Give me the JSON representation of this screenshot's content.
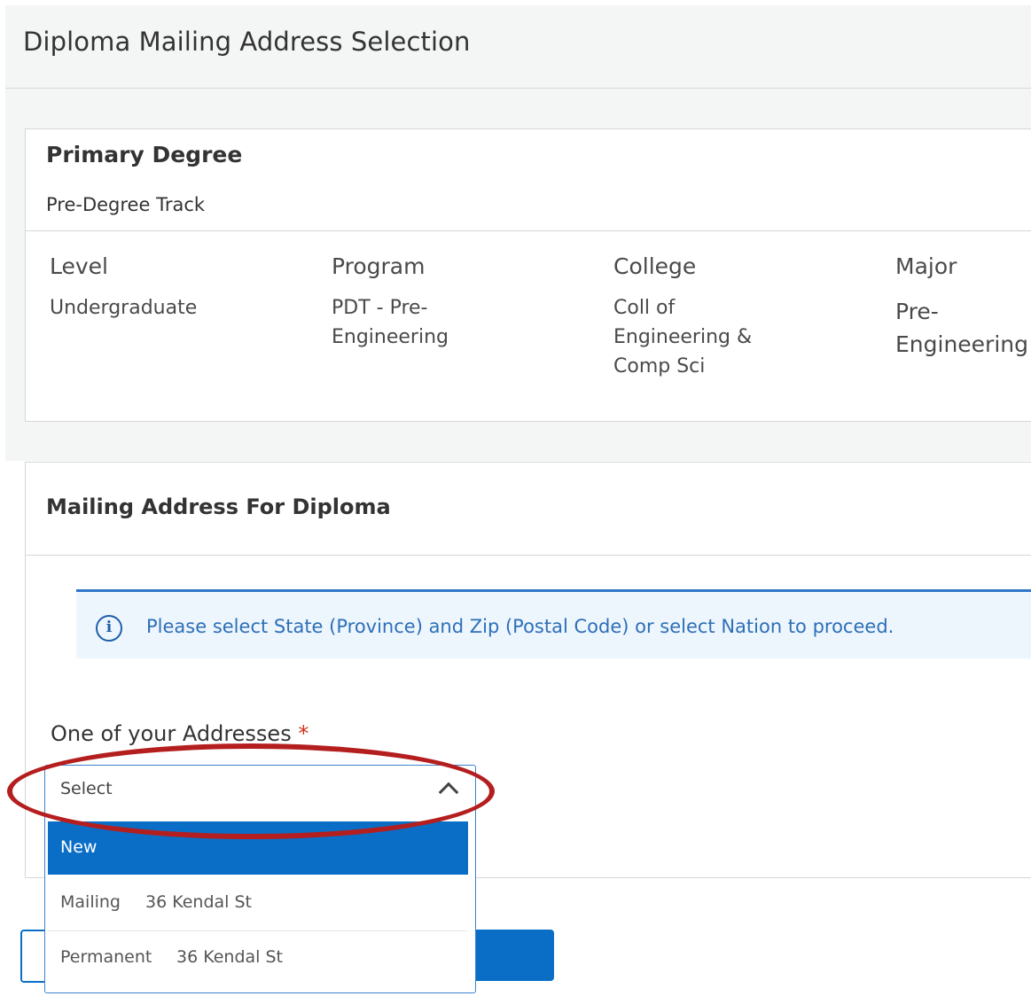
{
  "header": {
    "title": "Diploma Mailing Address Selection"
  },
  "degree": {
    "heading": "Primary Degree",
    "track": "Pre-Degree Track",
    "columns": [
      {
        "label": "Level",
        "value": "Undergraduate"
      },
      {
        "label": "Program",
        "value_lines": [
          "PDT - Pre-",
          "Engineering"
        ]
      },
      {
        "label": "College",
        "value_lines": [
          "Coll of",
          "Engineering &",
          "Comp Sci"
        ]
      },
      {
        "label": "Major",
        "value_lines": [
          "Pre-",
          "Engineering"
        ]
      }
    ]
  },
  "mailing": {
    "heading": "Mailing Address For Diploma",
    "info_message": "Please select State (Province) and Zip (Postal Code) or select Nation to proceed.",
    "field_label": "One of your Addresses",
    "required_mark": "*",
    "select": {
      "current": "Select",
      "options": [
        {
          "type": "New",
          "address": ""
        },
        {
          "type": "Mailing",
          "address": "36 Kendal St"
        },
        {
          "type": "Permanent",
          "address": "36 Kendal St"
        }
      ]
    }
  },
  "colors": {
    "accent": "#0a6ec6",
    "info_bg": "#eef6fd",
    "highlight_ellipse": "#b51e1e",
    "required": "#d0321e"
  }
}
